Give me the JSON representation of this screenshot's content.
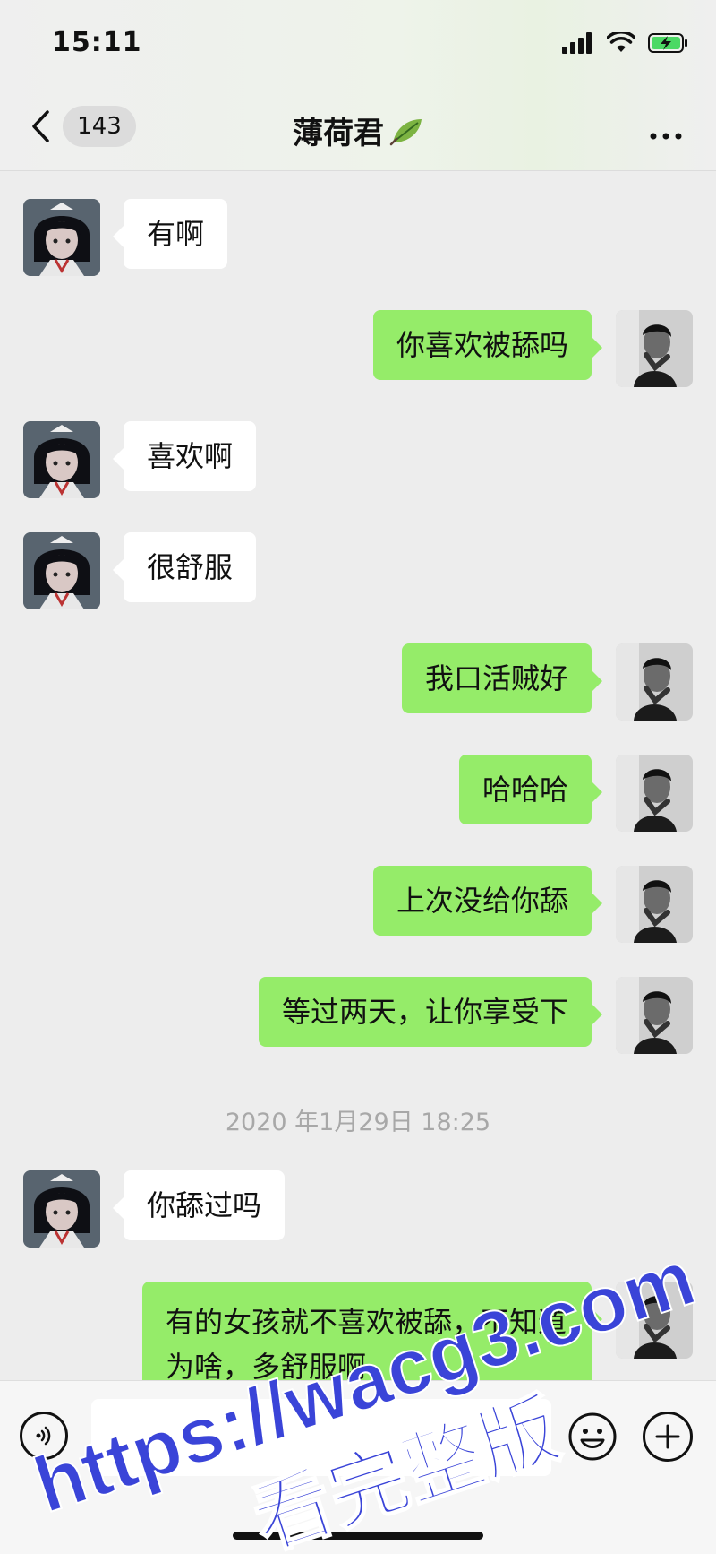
{
  "status_bar": {
    "time": "15:11"
  },
  "nav": {
    "unread_count": "143",
    "title": "薄荷君"
  },
  "messages": [
    {
      "side": "left",
      "text": "有啊"
    },
    {
      "side": "right",
      "text": "你喜欢被舔吗"
    },
    {
      "side": "left",
      "text": "喜欢啊"
    },
    {
      "side": "left",
      "text": "很舒服"
    },
    {
      "side": "right",
      "text": "我口活贼好"
    },
    {
      "side": "right",
      "text": "哈哈哈"
    },
    {
      "side": "right",
      "text": "上次没给你舔"
    },
    {
      "side": "right",
      "text": "等过两天，让你享受下"
    },
    {
      "side": "left",
      "text": "你舔过吗"
    },
    {
      "side": "right",
      "text": "有的女孩就不喜欢被舔，不知道为啥，多舒服啊"
    }
  ],
  "timestamp": "2020 年1月29日 18:25",
  "input": {
    "placeholder": ""
  },
  "watermark": {
    "line1": "https://wacg3.com",
    "line2": "看完整版"
  },
  "colors": {
    "sent_bubble": "#95ec69",
    "received_bubble": "#ffffff",
    "background": "#ededed"
  }
}
